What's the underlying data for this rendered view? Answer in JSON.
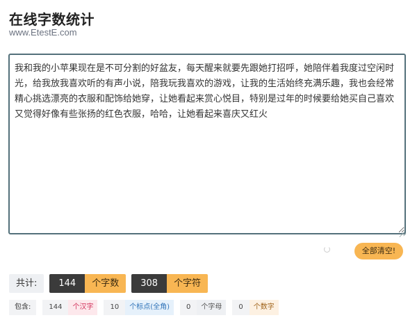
{
  "header": {
    "title": "在线字数统计",
    "subtitle": "www.EtestE.com"
  },
  "editor": {
    "text": "我和我的小苹果现在是不可分割的好盆友，每天醒来就要先跟她打招呼，她陪伴着我度过空闲时光，给我放我喜欢听的有声小说，陪我玩我喜欢的游戏，让我的生活始终充满乐趣，我也会经常精心挑选漂亮的衣服和配饰给她穿，让她看起来赏心悦目，特别是过年的时候要给她买自己喜欢又觉得好像有些张扬的红色衣服，哈哈，让她看起来喜庆又红火"
  },
  "actions": {
    "clear_label": "全部清空!"
  },
  "totals": {
    "label": "共计:",
    "chars_value": "144",
    "chars_unit": "个字数",
    "symbols_value": "308",
    "symbols_unit": "个字符"
  },
  "details": {
    "label": "包含:",
    "items": [
      {
        "value": "144",
        "unit": "个汉字"
      },
      {
        "value": "10",
        "unit": "个标点(全角)"
      },
      {
        "value": "0",
        "unit": "个字母"
      },
      {
        "value": "0",
        "unit": "个数字"
      }
    ]
  },
  "colors": {
    "accent": "#f8b653",
    "dark": "#3b3b3b",
    "border": "#53707a"
  }
}
